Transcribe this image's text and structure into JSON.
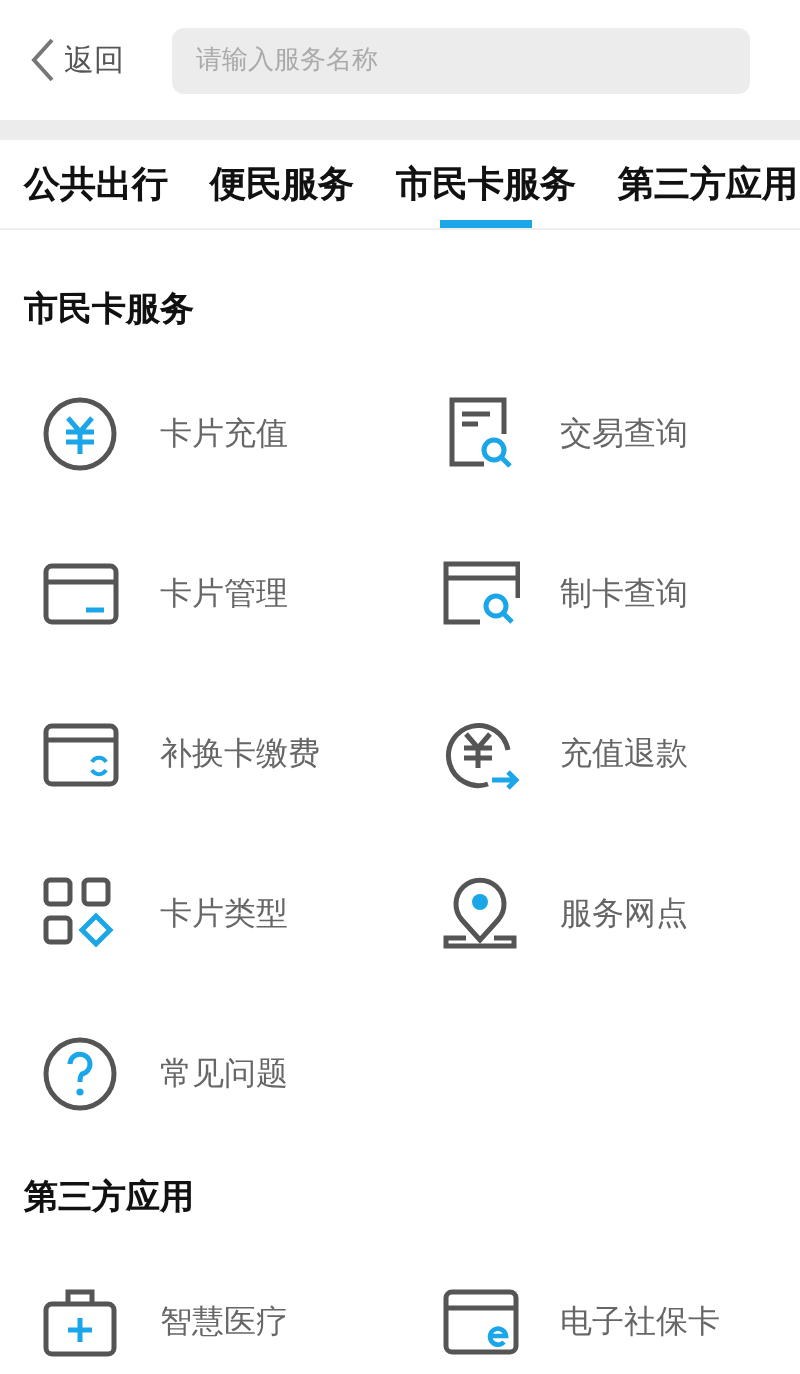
{
  "header": {
    "back_label": "返回",
    "search": {
      "placeholder": "请输入服务名称"
    }
  },
  "tabs": [
    {
      "label": "公共出行",
      "selected": false
    },
    {
      "label": "便民服务",
      "selected": false
    },
    {
      "label": "市民卡服务",
      "selected": true
    },
    {
      "label": "第三方应用",
      "selected": false
    }
  ],
  "sections": [
    {
      "title": "市民卡服务",
      "items": [
        {
          "label": "卡片充值",
          "kind": "yuan"
        },
        {
          "label": "交易查询",
          "kind": "receipt-search"
        },
        {
          "label": "卡片管理",
          "kind": "card-minus"
        },
        {
          "label": "制卡查询",
          "kind": "card-search"
        },
        {
          "label": "补换卡缴费",
          "kind": "card-refresh"
        },
        {
          "label": "充值退款",
          "kind": "yuan-refund"
        },
        {
          "label": "卡片类型",
          "kind": "grid"
        },
        {
          "label": "服务网点",
          "kind": "pin"
        },
        {
          "label": "常见问题",
          "kind": "question"
        }
      ]
    },
    {
      "title": "第三方应用",
      "items": [
        {
          "label": "智慧医疗",
          "kind": "medical"
        },
        {
          "label": "电子社保卡",
          "kind": "card-e"
        }
      ]
    }
  ]
}
